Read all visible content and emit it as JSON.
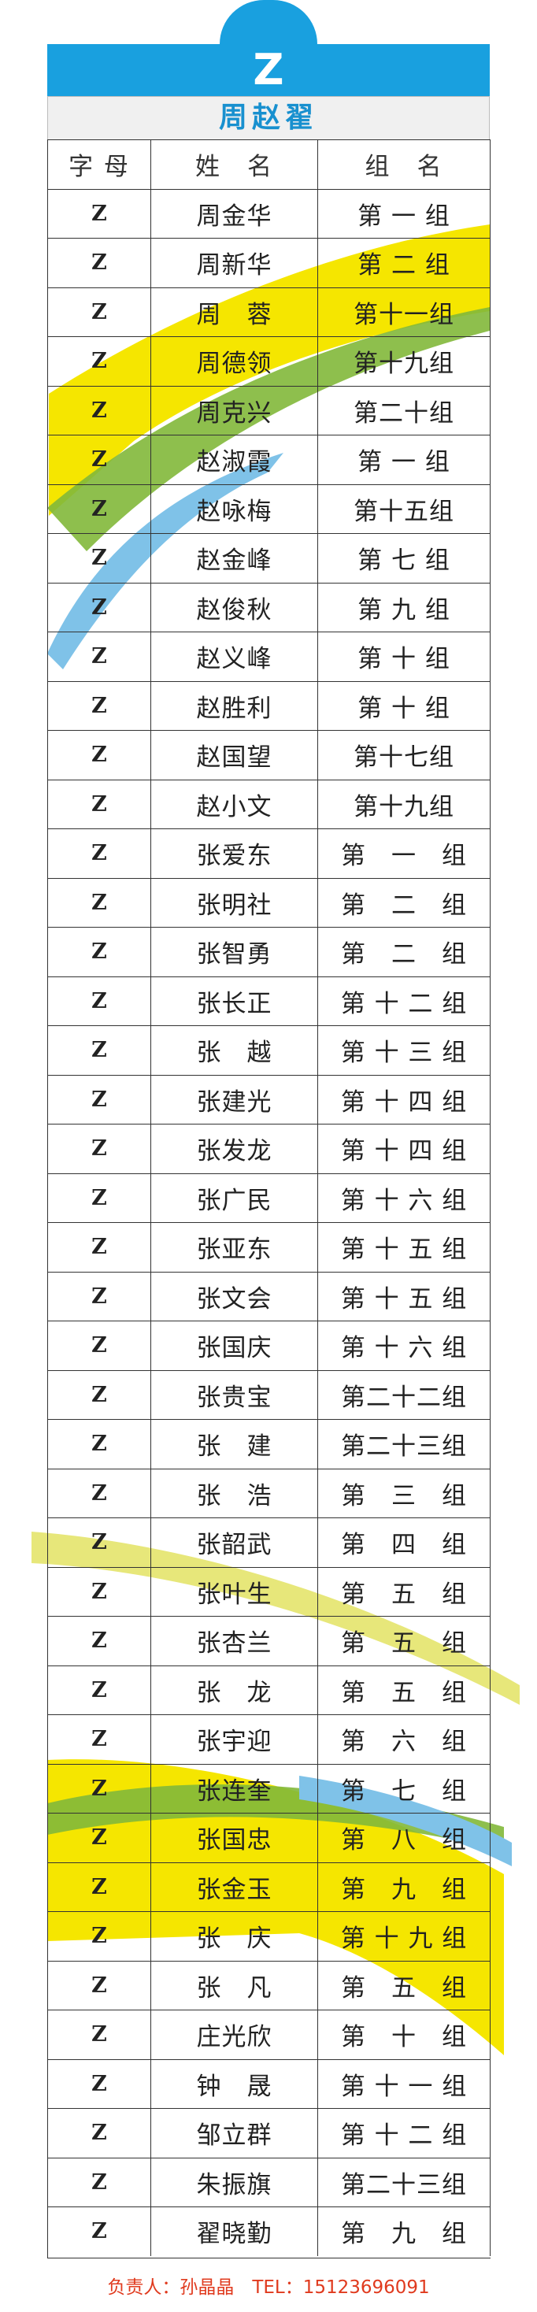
{
  "header": {
    "letter": "Z",
    "surnames": "周赵翟"
  },
  "table": {
    "columns": [
      "字 母",
      "姓　名",
      "组　名"
    ],
    "rows": [
      [
        "Z",
        "周金华",
        "第 一 组"
      ],
      [
        "Z",
        "周新华",
        "第 二 组"
      ],
      [
        "Z",
        "周　蓉",
        "第十一组"
      ],
      [
        "Z",
        "周德领",
        "第十九组"
      ],
      [
        "Z",
        "周克兴",
        "第二十组"
      ],
      [
        "Z",
        "赵淑霞",
        "第 一 组"
      ],
      [
        "Z",
        "赵咏梅",
        "第十五组"
      ],
      [
        "Z",
        "赵金峰",
        "第 七 组"
      ],
      [
        "Z",
        "赵俊秋",
        "第 九 组"
      ],
      [
        "Z",
        "赵义峰",
        "第 十 组"
      ],
      [
        "Z",
        "赵胜利",
        "第 十 组"
      ],
      [
        "Z",
        "赵国望",
        "第十七组"
      ],
      [
        "Z",
        "赵小文",
        "第十九组"
      ],
      [
        "Z",
        "张爱东",
        "第　一　组"
      ],
      [
        "Z",
        "张明社",
        "第　二　组"
      ],
      [
        "Z",
        "张智勇",
        "第　二　组"
      ],
      [
        "Z",
        "张长正",
        "第 十 二 组"
      ],
      [
        "Z",
        "张　越",
        "第 十 三 组"
      ],
      [
        "Z",
        "张建光",
        "第 十 四 组"
      ],
      [
        "Z",
        "张发龙",
        "第 十 四 组"
      ],
      [
        "Z",
        "张广民",
        "第 十 六 组"
      ],
      [
        "Z",
        "张亚东",
        "第 十 五 组"
      ],
      [
        "Z",
        "张文会",
        "第 十 五 组"
      ],
      [
        "Z",
        "张国庆",
        "第 十 六 组"
      ],
      [
        "Z",
        "张贵宝",
        "第二十二组"
      ],
      [
        "Z",
        "张　建",
        "第二十三组"
      ],
      [
        "Z",
        "张　浩",
        "第　三　组"
      ],
      [
        "Z",
        "张韶武",
        "第　四　组"
      ],
      [
        "Z",
        "张叶生",
        "第　五　组"
      ],
      [
        "Z",
        "张杏兰",
        "第　五　组"
      ],
      [
        "Z",
        "张　龙",
        "第　五　组"
      ],
      [
        "Z",
        "张宇迎",
        "第　六　组"
      ],
      [
        "Z",
        "张连奎",
        "第　七　组"
      ],
      [
        "Z",
        "张国忠",
        "第　八　组"
      ],
      [
        "Z",
        "张金玉",
        "第　九　组"
      ],
      [
        "Z",
        "张　庆",
        "第 十 九 组"
      ],
      [
        "Z",
        "张　凡",
        "第　五　组"
      ],
      [
        "Z",
        "庄光欣",
        "第　十　组"
      ],
      [
        "Z",
        "钟　晟",
        "第 十 一 组"
      ],
      [
        "Z",
        "邹立群",
        "第 十 二 组"
      ],
      [
        "Z",
        "朱振旗",
        "第二十三组"
      ],
      [
        "Z",
        "翟晓勤",
        "第　九　组"
      ]
    ]
  },
  "footer": {
    "text": "负责人：孙晶晶　TEL：15123696091"
  },
  "colors": {
    "header_blue": "#19a0df",
    "wave_yellow": "#f5e600",
    "wave_green": "#82b83a",
    "wave_blue": "#7fc2e8",
    "footer_red": "#e03a1e"
  }
}
